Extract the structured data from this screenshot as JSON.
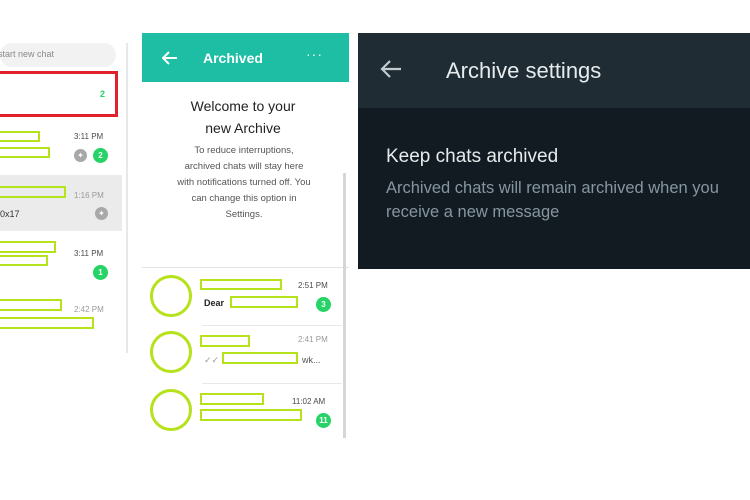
{
  "left_panel": {
    "search_placeholder": "start new chat",
    "archived_count": "2",
    "chats": [
      {
        "time": "3:11 PM",
        "badge": "2"
      },
      {
        "time": "1:16 PM",
        "preview": "0x17"
      },
      {
        "time": "3:11 PM",
        "badge": "1"
      },
      {
        "time": "2:42 PM"
      }
    ]
  },
  "middle_panel": {
    "title": "Archived",
    "back_icon": "arrow-left-icon",
    "menu_icon": "more-horizontal-icon",
    "welcome_title": "Welcome to your new Archive",
    "welcome_text": "To reduce interruptions, archived chats will stay here with notifications turned off. You can change this option in Settings.",
    "chats": [
      {
        "time": "2:51 PM",
        "preview": "Dear",
        "badge": "3"
      },
      {
        "time": "2:41 PM",
        "preview": "wk..."
      },
      {
        "time": "11:02 AM",
        "badge": "11"
      }
    ]
  },
  "right_panel": {
    "title": "Archive settings",
    "back_icon": "arrow-left-icon",
    "setting_title": "Keep chats archived",
    "setting_desc": "Archived chats will remain archived when you receive a new message"
  },
  "colors": {
    "accent": "#1ebea5",
    "highlight": "#b5e21a",
    "badge": "#25d366",
    "dark_header": "#1f2c34",
    "dark_body": "#121b22",
    "red_box": "#e0202a"
  }
}
